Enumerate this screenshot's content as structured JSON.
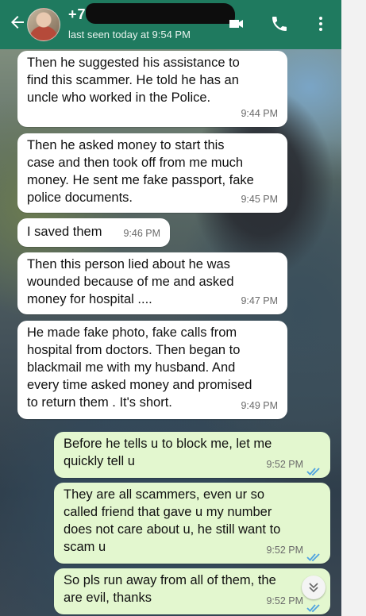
{
  "header": {
    "back_icon": "arrow-left-icon",
    "contact_name": "+7 9",
    "last_seen": "last seen today at 9:54 PM",
    "video_icon": "video-camera-icon",
    "call_icon": "phone-icon",
    "menu_icon": "more-vertical-icon",
    "color": "#1f7a5f"
  },
  "messages": [
    {
      "direction": "in",
      "lines": [
        "Then he suggested his assistance to",
        "find this scammer. He told he has an",
        "uncle who worked in the Police."
      ],
      "time": "9:44 PM"
    },
    {
      "direction": "in",
      "lines": [
        "Then he asked money to start this",
        "case and then took off from me much",
        "money. He sent me fake passport, fake",
        "police documents."
      ],
      "time": "9:45 PM"
    },
    {
      "direction": "in",
      "lines": [
        "I saved them"
      ],
      "time": "9:46 PM"
    },
    {
      "direction": "in",
      "lines": [
        "Then this person lied about he was",
        "wounded because of me and asked",
        "money for hospital ...."
      ],
      "time": "9:47 PM"
    },
    {
      "direction": "in",
      "lines": [
        "He made fake photo, fake calls from",
        "hospital from doctors. Then began to",
        "blackmail me with my husband. And",
        "every time asked money and promised",
        "to return them . It's short."
      ],
      "time": "9:49 PM"
    },
    {
      "direction": "out",
      "lines": [
        "Before he tells u to block me, let me",
        "quickly tell u"
      ],
      "time": "9:52 PM",
      "status": "read"
    },
    {
      "direction": "out",
      "lines": [
        "They are all scammers, even ur so",
        "called friend that gave u my number",
        "does not care about u, he still want to",
        "scam u"
      ],
      "time": "9:52 PM",
      "status": "read"
    },
    {
      "direction": "out",
      "lines": [
        "So pls run away from all of them, the",
        "are evil, thanks"
      ],
      "time": "9:52 PM",
      "status": "read"
    }
  ],
  "scroll_down_icon": "chevron-double-down-icon",
  "colors": {
    "incoming": "#ffffff",
    "outgoing": "#e3f7cf",
    "read_ticks": "#4fa3e0"
  }
}
